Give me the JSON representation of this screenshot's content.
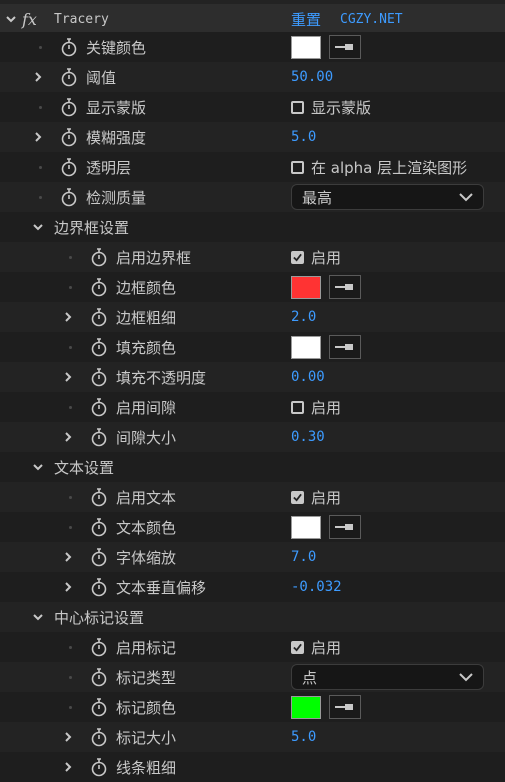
{
  "effect": {
    "fx": "fx",
    "name": "Tracery",
    "reset": "重置",
    "about": "CGZY.NET",
    "colors": {
      "accent_blue": "#3d9bff",
      "text": "#c8c8c8",
      "bg": "#232323"
    }
  },
  "props": {
    "key_color": {
      "label": "关键颜色",
      "color": "#ffffff"
    },
    "threshold": {
      "label": "阈值",
      "value": "50.00"
    },
    "show_mask": {
      "label": "显示蒙版",
      "checkbox_label": "显示蒙版",
      "checked": false
    },
    "blur": {
      "label": "模糊强度",
      "value": "5.0"
    },
    "transparent_layer": {
      "label": "透明层",
      "checkbox_label": "在 alpha 层上渲染图形",
      "checked": false
    },
    "quality": {
      "label": "检测质量",
      "selected": "最高"
    },
    "border_group": {
      "label": "边界框设置"
    },
    "enable_border": {
      "label": "启用边界框",
      "checkbox_label": "启用",
      "checked": true
    },
    "border_color": {
      "label": "边框颜色",
      "color": "#ff3333"
    },
    "border_width": {
      "label": "边框粗细",
      "value": "2.0"
    },
    "fill_color": {
      "label": "填充颜色",
      "color": "#ffffff"
    },
    "fill_opacity": {
      "label": "填充不透明度",
      "value": "0.00"
    },
    "enable_gap": {
      "label": "启用间隙",
      "checkbox_label": "启用",
      "checked": false
    },
    "gap_size": {
      "label": "间隙大小",
      "value": "0.30"
    },
    "text_group": {
      "label": "文本设置"
    },
    "enable_text": {
      "label": "启用文本",
      "checkbox_label": "启用",
      "checked": true
    },
    "text_color": {
      "label": "文本颜色",
      "color": "#ffffff"
    },
    "font_scale": {
      "label": "字体缩放",
      "value": "7.0"
    },
    "text_offset": {
      "label": "文本垂直偏移",
      "value": "-0.032"
    },
    "marker_group": {
      "label": "中心标记设置"
    },
    "enable_marker": {
      "label": "启用标记",
      "checkbox_label": "启用",
      "checked": true
    },
    "marker_type": {
      "label": "标记类型",
      "selected": "点"
    },
    "marker_color": {
      "label": "标记颜色",
      "color": "#00ff00"
    },
    "marker_size": {
      "label": "标记大小",
      "value": "5.0"
    },
    "line_width": {
      "label": "线条粗细"
    }
  }
}
